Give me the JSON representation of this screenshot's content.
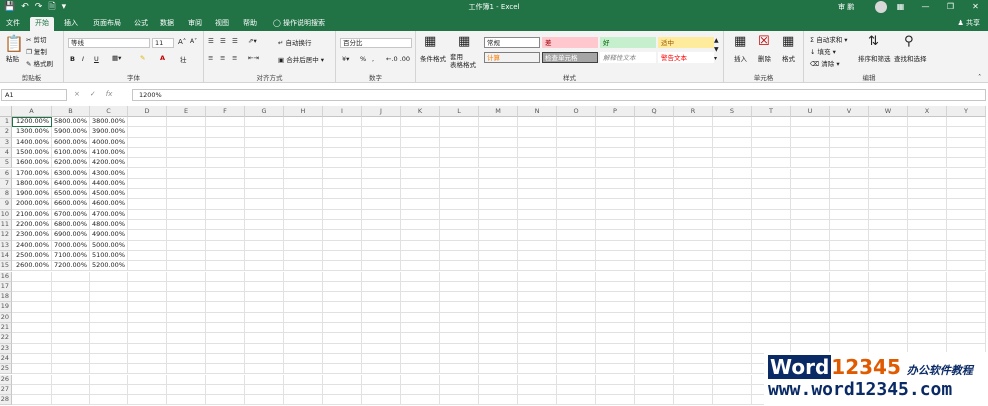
{
  "titlebar": {
    "save_icon": "save-icon",
    "undo_icon": "undo-icon",
    "redo_icon": "redo-icon",
    "new_icon": "new-document-icon",
    "more_icon": "customize-icon",
    "title": "工作簿1 - Excel",
    "user": "审 鹏",
    "win_buttons": [
      "ribbon-display-icon",
      "minimize-icon",
      "restore-icon",
      "close-icon"
    ]
  },
  "tabs": {
    "items": [
      "文件",
      "开始",
      "插入",
      "页面布局",
      "公式",
      "数据",
      "审阅",
      "视图",
      "帮助"
    ],
    "active": "开始",
    "tell_me": "操作说明搜索",
    "share": "共享"
  },
  "ribbon": {
    "clipboard": {
      "paste": "粘贴",
      "cut": "剪切",
      "copy": "复制",
      "format_painter": "格式刷",
      "label": "剪贴板"
    },
    "font": {
      "name": "等线",
      "size": "11",
      "bold": "B",
      "italic": "I",
      "underline": "U",
      "label": "字体"
    },
    "alignment": {
      "wrap_text": "自动换行",
      "merge_center": "合并后居中",
      "label": "对齐方式"
    },
    "number": {
      "format": "百分比",
      "percent": "%",
      "comma": ",",
      "label": "数字"
    },
    "styles": {
      "conditional": "条件格式",
      "table": "套用\n表格格式",
      "cells": [
        {
          "text": "常规",
          "bg": "#ffffff",
          "fg": "#222222",
          "border": "#888888"
        },
        {
          "text": "差",
          "bg": "#ffc7ce",
          "fg": "#9c0006",
          "border": "#ffc7ce"
        },
        {
          "text": "好",
          "bg": "#c6efce",
          "fg": "#006100",
          "border": "#c6efce"
        },
        {
          "text": "适中",
          "bg": "#ffeb9c",
          "fg": "#9c5700",
          "border": "#ffeb9c"
        },
        {
          "text": "计算",
          "bg": "#f2f2f2",
          "fg": "#fa7d00",
          "border": "#7f7f7f"
        },
        {
          "text": "检查单元格",
          "bg": "#a5a5a5",
          "fg": "#ffffff",
          "border": "#3f3f3f"
        },
        {
          "text": "解释性文本",
          "bg": "#ffffff",
          "fg": "#7f7f7f",
          "border": "#ffffff"
        },
        {
          "text": "警告文本",
          "bg": "#ffffff",
          "fg": "#ff0000",
          "border": "#ffffff"
        }
      ],
      "label": "样式"
    },
    "cells_group": {
      "insert": "插入",
      "delete": "删除",
      "format": "格式",
      "label": "单元格"
    },
    "editing": {
      "autosum": "自动求和",
      "fill": "填充",
      "clear": "清除",
      "sort_filter": "排序和筛选",
      "find_select": "查找和选择",
      "label": "编辑"
    }
  },
  "formula_bar": {
    "name_box": "A1",
    "cancel": "×",
    "enter": "✓",
    "fx": "fx",
    "value": "1200%"
  },
  "sheet": {
    "columns": [
      "A",
      "B",
      "C",
      "D",
      "E",
      "F",
      "G",
      "H",
      "I",
      "J",
      "K",
      "L",
      "M",
      "N",
      "O",
      "P",
      "Q",
      "R",
      "S",
      "T",
      "U",
      "V",
      "W",
      "X",
      "Y"
    ],
    "row_count": 28,
    "data": [
      [
        "1200.00%",
        "5800.00%",
        "3800.00%"
      ],
      [
        "1300.00%",
        "5900.00%",
        "3900.00%"
      ],
      [
        "1400.00%",
        "6000.00%",
        "4000.00%"
      ],
      [
        "1500.00%",
        "6100.00%",
        "4100.00%"
      ],
      [
        "1600.00%",
        "6200.00%",
        "4200.00%"
      ],
      [
        "1700.00%",
        "6300.00%",
        "4300.00%"
      ],
      [
        "1800.00%",
        "6400.00%",
        "4400.00%"
      ],
      [
        "1900.00%",
        "6500.00%",
        "4500.00%"
      ],
      [
        "2000.00%",
        "6600.00%",
        "4600.00%"
      ],
      [
        "2100.00%",
        "6700.00%",
        "4700.00%"
      ],
      [
        "2200.00%",
        "6800.00%",
        "4800.00%"
      ],
      [
        "2300.00%",
        "6900.00%",
        "4900.00%"
      ],
      [
        "2400.00%",
        "7000.00%",
        "5000.00%"
      ],
      [
        "2500.00%",
        "7100.00%",
        "5100.00%"
      ],
      [
        "2600.00%",
        "7200.00%",
        "5200.00%"
      ]
    ]
  },
  "watermark": {
    "line1_word": "Word",
    "line1_num": "12345",
    "line1_cn": "办公软件教程",
    "line2": "www.word12345.com"
  },
  "colors": {
    "accent": "#217346",
    "ribbon_bg": "#f3f3f3"
  }
}
